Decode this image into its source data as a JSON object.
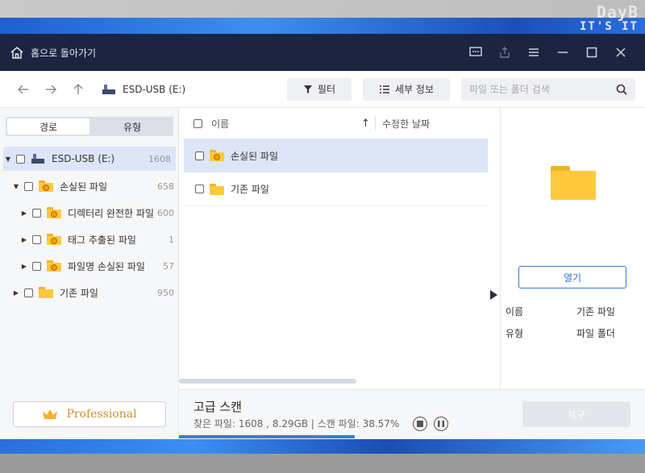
{
  "desktop": {
    "watermark_line1": "DayB",
    "watermark_line2": "IT'S IT"
  },
  "titlebar": {
    "home_label": "홈으로 돌아가기"
  },
  "toolbar": {
    "drive_label": "ESD-USB (E:)",
    "filter_label": "필터",
    "details_label": "세부 정보",
    "search_placeholder": "파일 또는 폴더 검색"
  },
  "left": {
    "tabs": [
      "경로",
      "유형"
    ],
    "tree": [
      {
        "label": "ESD-USB (E:)",
        "count": "1608"
      },
      {
        "label": "손실된 파일",
        "count": "658"
      },
      {
        "label": "디렉터리 완전한 파일",
        "count": "600"
      },
      {
        "label": "태그 추출된 파일",
        "count": "1"
      },
      {
        "label": "파일명 손실된 파일",
        "count": "57"
      },
      {
        "label": "기존 파일",
        "count": "950"
      }
    ],
    "pro_label": "Professional"
  },
  "list": {
    "col_name": "이름",
    "col_date": "수정한 날짜",
    "rows": [
      {
        "name": "손실된 파일"
      },
      {
        "name": "기존 파일"
      }
    ]
  },
  "preview": {
    "open_label": "열기",
    "props": [
      {
        "key": "이름",
        "value": "기존 파일"
      },
      {
        "key": "유형",
        "value": "파일 폴더"
      }
    ]
  },
  "status": {
    "title": "고급 스캔",
    "detail": "찾은 파일: 1608 , 8.29GB | 스캔 파일: 38.57%",
    "progress": 0.3857,
    "recover_label": "복구"
  }
}
